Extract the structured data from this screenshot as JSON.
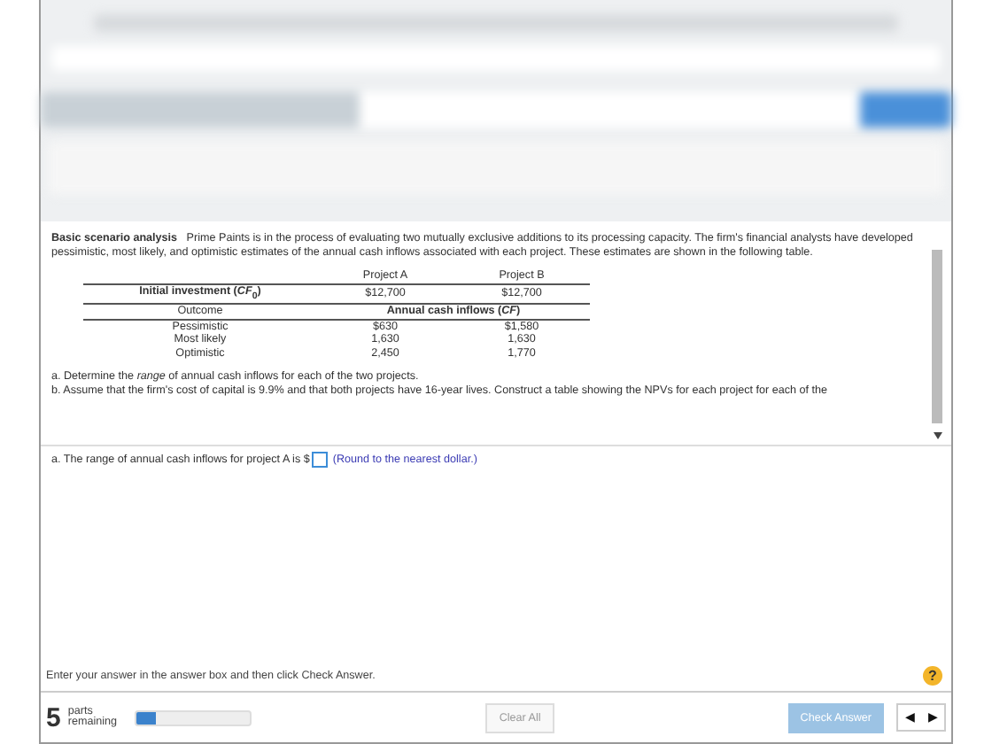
{
  "problem": {
    "title": "Basic scenario analysis",
    "text": "Prime Paints is in the process of evaluating two mutually exclusive additions to its processing capacity. The firm's financial analysts have developed pessimistic, most likely, and optimistic estimates of the annual cash inflows associated with each project. These estimates are shown in the following table."
  },
  "table": {
    "columns": [
      "Project A",
      "Project B"
    ],
    "investment": {
      "label": "Initial investment (*CF*$_{0}$)",
      "values": [
        "$12,700",
        "$12,700"
      ]
    },
    "outcome_header": "Outcome",
    "inflows_header": "Annual cash inflows (*CF*)",
    "rows": [
      {
        "label": "Pessimistic",
        "values": [
          "$630",
          "$1,580"
        ]
      },
      {
        "label": "Most likely",
        "values": [
          "1,630",
          "1,630"
        ]
      },
      {
        "label": "Optimistic",
        "values": [
          "2,450",
          "1,770"
        ]
      }
    ]
  },
  "questions": [
    "a. Determine the *range* of annual cash inflows for each of the two projects.",
    "b. Assume that the firm's cost of capital is 9.9% and that both projects have 16-year lives. Construct a table showing the NPVs for each project for each of the"
  ],
  "answer": {
    "prefix": "a. The range of annual cash inflows for project A is $",
    "hint": "(Round to the nearest dollar.)"
  },
  "instruction": "Enter your answer in the answer box and then click Check Answer.",
  "help": "?",
  "footer": {
    "parts_count": "5",
    "parts_label": "parts remaining",
    "level": 0.16,
    "clear": "Clear All",
    "check": "Check Answer",
    "check_disabled": true,
    "prev": "◀",
    "next": "▶"
  }
}
